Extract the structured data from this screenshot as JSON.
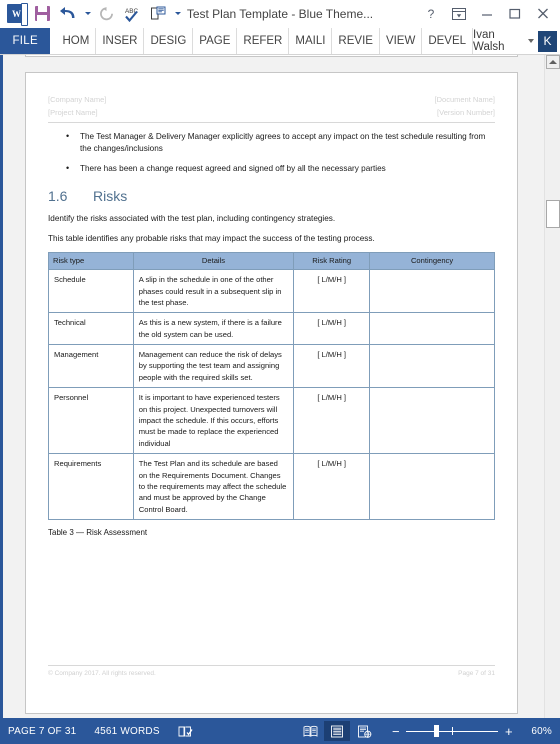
{
  "titlebar": {
    "quick_access": [
      {
        "name": "word-logo-icon",
        "label": "W"
      },
      {
        "name": "save-icon",
        "label": "Save"
      },
      {
        "name": "undo-icon",
        "label": "Undo"
      },
      {
        "name": "redo-icon",
        "label": "Redo"
      },
      {
        "name": "spelling-icon",
        "label": "Spelling & Grammar"
      },
      {
        "name": "print-preview-icon",
        "label": "Print Preview"
      },
      {
        "name": "customize-qat-icon",
        "label": "Customize Quick Access Toolbar"
      }
    ],
    "title": "Test Plan Template - Blue Theme...",
    "help_label": "?",
    "ribbon_options_label": "Ribbon Display Options",
    "minimize_label": "—",
    "maximize_label": "❐",
    "close_label": "✕"
  },
  "ribbon": {
    "file_tab": "FILE",
    "tabs": [
      "HOM",
      "INSER",
      "DESIG",
      "PAGE",
      "REFER",
      "MAILI",
      "REVIE",
      "VIEW",
      "DEVEL"
    ],
    "account_name": "Ivan Walsh",
    "avatar_initial": "K"
  },
  "document": {
    "header": {
      "left_line1": "[Company Name]",
      "left_line2": "[Project Name]",
      "right_line1": "[Document Name]",
      "right_line2": "[Version Number]"
    },
    "bullets": [
      "The Test Manager & Delivery Manager explicitly agrees to accept any impact on the test schedule resulting from the changes/inclusions",
      "There has been a change request agreed and signed off by all the necessary parties"
    ],
    "heading": {
      "number": "1.6",
      "text": "Risks"
    },
    "paragraphs": [
      "Identify the risks associated with the test plan, including contingency strategies.",
      "This table identifies any probable risks that may impact the success of the testing process."
    ],
    "table": {
      "headers": [
        "Risk type",
        "Details",
        "Risk Rating",
        "Contingency"
      ],
      "rows": [
        {
          "risk_type": "Schedule",
          "details": "A slip in the schedule in one of the other phases could result in a subsequent slip in the test phase.",
          "risk_rating": "[ L/M/H ]",
          "contingency": ""
        },
        {
          "risk_type": "Technical",
          "details": "As this is a new system, if there is a failure the old system can be used.",
          "risk_rating": "[ L/M/H ]",
          "contingency": ""
        },
        {
          "risk_type": "Management",
          "details": "Management can reduce the risk of delays by supporting the test team and assigning people with the required skills set.",
          "risk_rating": "[ L/M/H ]",
          "contingency": ""
        },
        {
          "risk_type": "Personnel",
          "details": "It is important to have experienced testers on this project. Unexpected turnovers will impact the schedule. If this occurs, efforts must be made to replace the experienced individual",
          "risk_rating": "[ L/M/H ]",
          "contingency": ""
        },
        {
          "risk_type": "Requirements",
          "details": "The Test Plan and its schedule are based on the Requirements Document. Changes to the requirements may affect the schedule and must be approved by the Change Control Board.",
          "risk_rating": "[ L/M/H ]",
          "contingency": ""
        }
      ]
    },
    "caption": "Table 3 — Risk Assessment",
    "footer": {
      "left": "© Company 2017. All rights reserved.",
      "right": "Page 7 of 31"
    }
  },
  "statusbar": {
    "page_label": "PAGE 7 OF 31",
    "word_count": "4561 WORDS",
    "proofing_label": "Proofing errors",
    "views": [
      {
        "name": "read-mode-view-button",
        "label": "Read Mode"
      },
      {
        "name": "print-layout-view-button",
        "label": "Print Layout"
      },
      {
        "name": "web-layout-view-button",
        "label": "Web Layout"
      }
    ],
    "zoom_out_label": "−",
    "zoom_in_label": "+",
    "zoom_level": "60%"
  },
  "colors": {
    "word_blue": "#2b579a",
    "table_header": "#95b3d7",
    "heading_blue": "#51718f"
  }
}
